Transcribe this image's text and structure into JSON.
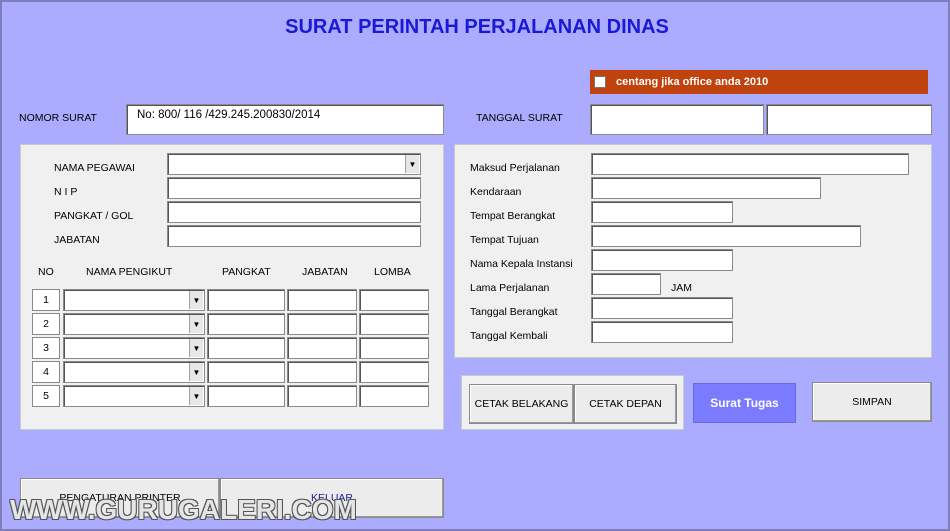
{
  "title": "SURAT PERINTAH PERJALANAN DINAS",
  "office_checkbox": {
    "label": "centang jika office anda 2010",
    "checked": false
  },
  "nomor_surat": {
    "label": "NOMOR SURAT",
    "value": "No: 800/ 116 /429.245.200830/2014"
  },
  "tanggal_surat": {
    "label": "TANGGAL SURAT",
    "value1": "",
    "value2": ""
  },
  "pegawai": {
    "nama_label": "NAMA PEGAWAI",
    "nip_label": "N I P",
    "pangkat_label": "PANGKAT / GOL",
    "jabatan_label": "JABATAN"
  },
  "pengikut": {
    "headers": {
      "no": "NO",
      "nama": "NAMA PENGIKUT",
      "pangkat": "PANGKAT",
      "jabatan": "JABATAN",
      "lomba": "LOMBA"
    },
    "rows": [
      {
        "no": "1"
      },
      {
        "no": "2"
      },
      {
        "no": "3"
      },
      {
        "no": "4"
      },
      {
        "no": "5"
      }
    ]
  },
  "perjalanan": {
    "maksud_label": "Maksud Perjalanan",
    "kendaraan_label": "Kendaraan",
    "berangkat_label": "Tempat Berangkat",
    "tujuan_label": "Tempat Tujuan",
    "kepala_label": "Nama Kepala Instansi",
    "lama_label": "Lama Perjalanan",
    "jam_label": "JAM",
    "tgl_berangkat_label": "Tanggal Berangkat",
    "tgl_kembali_label": "Tanggal Kembali"
  },
  "buttons": {
    "cetak_belakang": "CETAK BELAKANG",
    "cetak_depan": "CETAK DEPAN",
    "surat_tugas": "Surat Tugas",
    "simpan": "SIMPAN",
    "pengaturan_printer": "PENGATURAN PRINTER",
    "keluar": "KELUAR"
  },
  "watermark": "WWW.GURUGALERI.COM",
  "colors": {
    "background": "#ababff",
    "title": "#1a1ad6",
    "checkbar": "#c0420d",
    "surat_tugas_btn": "#7b7bff"
  }
}
